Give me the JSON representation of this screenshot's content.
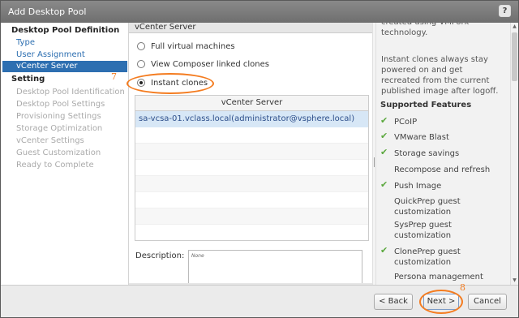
{
  "window": {
    "title": "Add Desktop Pool",
    "help_label": "?"
  },
  "sidebar": {
    "section1": "Desktop Pool Definition",
    "steps1": [
      "Type",
      "User Assignment",
      "vCenter Server"
    ],
    "section2": "Setting",
    "steps2": [
      "Desktop Pool Identification",
      "Desktop Pool Settings",
      "Provisioning Settings",
      "Storage Optimization",
      "vCenter Settings",
      "Guest Customization",
      "Ready to Complete"
    ]
  },
  "main": {
    "header": "vCenter Server",
    "options": [
      "Full virtual machines",
      "View Composer linked clones",
      "Instant clones"
    ],
    "selected_option": "Instant clones",
    "table": {
      "header": "vCenter Server",
      "rows": [
        "sa-vcsa-01.vclass.local(administrator@vsphere.local)"
      ]
    },
    "description_label": "Description:",
    "description_value": "None"
  },
  "info_panel": {
    "partial_text": "created using VMFork technology.",
    "paragraph": "Instant clones always stay powered on and get recreated from the current published image after logoff.",
    "features_heading": "Supported Features",
    "features": [
      {
        "label": "PCoIP",
        "checked": true
      },
      {
        "label": "VMware Blast",
        "checked": true
      },
      {
        "label": "Storage savings",
        "checked": true
      },
      {
        "label": "Recompose and refresh",
        "checked": false
      },
      {
        "label": "Push Image",
        "checked": true
      },
      {
        "label": "QuickPrep guest customization",
        "checked": false
      },
      {
        "label": "SysPrep guest customization",
        "checked": false
      },
      {
        "label": "ClonePrep guest customization",
        "checked": true
      },
      {
        "label": "Persona management",
        "checked": false
      }
    ]
  },
  "annotations": {
    "step7": "7",
    "step8": "8",
    "color": "#f47c20"
  },
  "footer": {
    "back_label": "< Back",
    "next_label": "Next >",
    "cancel_label": "Cancel"
  },
  "colors": {
    "accent": "#2d6fb1",
    "titlebar": "#7a7a7a",
    "check": "#5ba83e"
  }
}
